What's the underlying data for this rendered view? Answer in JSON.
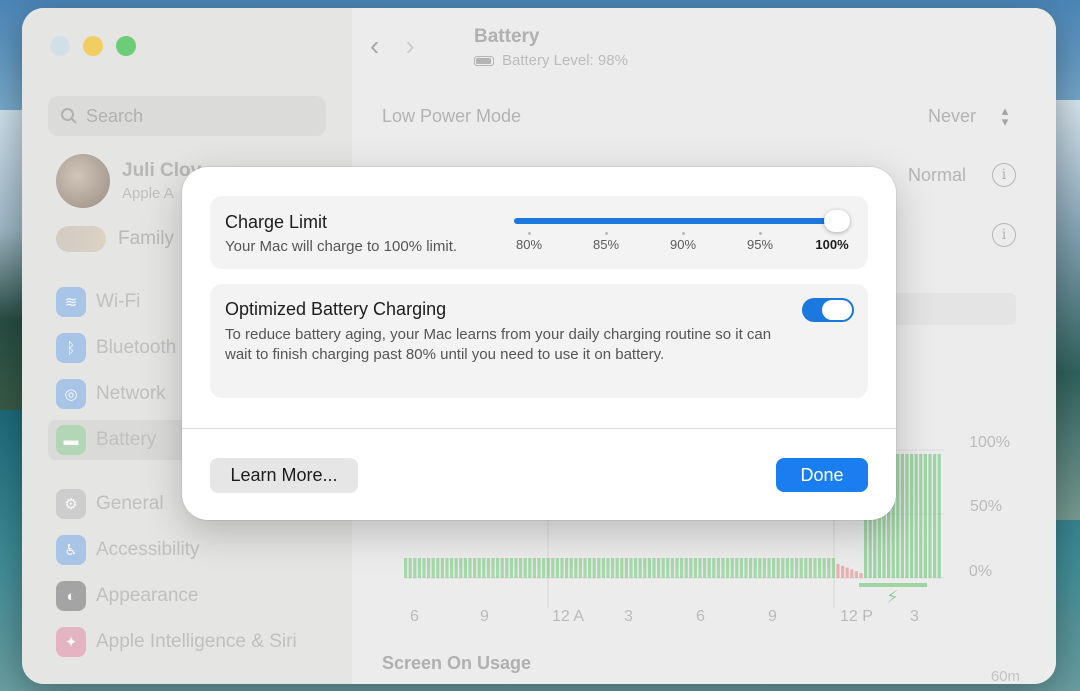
{
  "window": {
    "title": "Battery",
    "subtitle": "Battery Level: 98%"
  },
  "sidebar": {
    "search_placeholder": "Search",
    "profile": {
      "name": "Juli Clov",
      "sub": "Apple A"
    },
    "family_label": "Family",
    "items": [
      {
        "label": "Wi-Fi",
        "icon": "wifi-icon",
        "color": "#2f7fe8"
      },
      {
        "label": "Bluetooth",
        "icon": "bluetooth-icon",
        "color": "#2f7fe8"
      },
      {
        "label": "Network",
        "icon": "network-icon",
        "color": "#2f7fe8"
      },
      {
        "label": "Battery",
        "icon": "battery-icon",
        "color": "#3cb94a"
      },
      {
        "label": "General",
        "icon": "gear-icon",
        "color": "#8e8e93"
      },
      {
        "label": "Accessibility",
        "icon": "accessibility-icon",
        "color": "#2f7fe8"
      },
      {
        "label": "Appearance",
        "icon": "appearance-icon",
        "color": "#1d1d1d"
      },
      {
        "label": "Apple Intelligence & Siri",
        "icon": "siri-icon",
        "color": "#d65a7a"
      }
    ]
  },
  "main": {
    "low_power_label": "Low Power Mode",
    "low_power_value": "Never",
    "row2_value": "Normal",
    "segment_partial": "s",
    "chart_y_labels": [
      "100%",
      "50%",
      "0%"
    ],
    "chart_x_labels": [
      "6",
      "9",
      "12 A",
      "3",
      "6",
      "9",
      "12 P",
      "3"
    ],
    "screen_on_label": "Screen On Usage",
    "bottom_right_label": "60m"
  },
  "modal": {
    "charge_limit_title": "Charge Limit",
    "charge_limit_desc": "Your Mac will charge to 100% limit.",
    "slider_ticks": [
      "80%",
      "85%",
      "90%",
      "95%",
      "100%"
    ],
    "slider_value": 100,
    "optimized_title": "Optimized Battery Charging",
    "optimized_desc": "To reduce battery aging, your Mac learns from your daily charging routine so it can wait to finish charging past 80% until you need to use it on battery.",
    "optimized_enabled": true,
    "learn_more": "Learn More...",
    "done": "Done"
  },
  "colors": {
    "accent": "#1a78de",
    "battery_green": "#3cb94a",
    "battery_red": "#e25a5a"
  }
}
